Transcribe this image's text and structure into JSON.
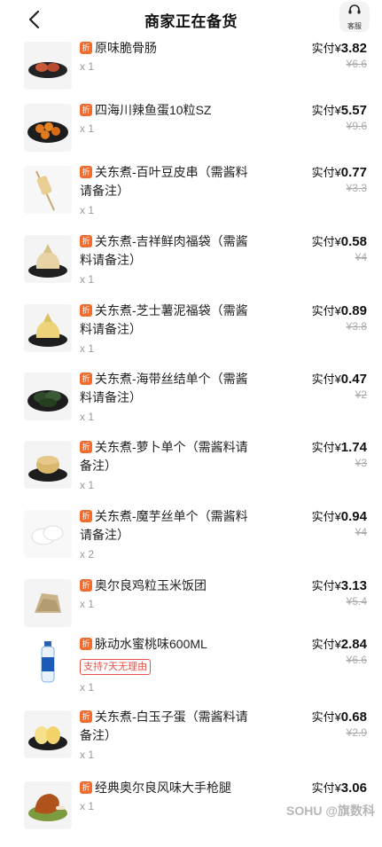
{
  "header": {
    "title": "商家正在备货",
    "service_label": "客服"
  },
  "tag_label": "折",
  "paid_prefix": "实付",
  "currency": "¥",
  "items": [
    {
      "name": "原味脆骨肠",
      "qty": "x 1",
      "paid": "3.82",
      "original": "¥6.6",
      "img": "sausage-image"
    },
    {
      "name": "四海川辣鱼蛋10粒SZ",
      "qty": "x 1",
      "paid": "5.57",
      "original": "¥9.6",
      "img": "fishball-image"
    },
    {
      "name": "关东煮-百叶豆皮串（需酱料请备注）",
      "qty": "x 1",
      "paid": "0.77",
      "original": "¥3.3",
      "img": "tofu-skewer-image"
    },
    {
      "name": "关东煮-吉祥鲜肉福袋（需酱料请备注）",
      "qty": "x 1",
      "paid": "0.58",
      "original": "¥4",
      "img": "meat-pouch-image"
    },
    {
      "name": "关东煮-芝士薯泥福袋（需酱料请备注）",
      "qty": "x 1",
      "paid": "0.89",
      "original": "¥3.8",
      "img": "cheese-pouch-image"
    },
    {
      "name": "关东煮-海带丝结单个（需酱料请备注）",
      "qty": "x 1",
      "paid": "0.47",
      "original": "¥2",
      "img": "kelp-knot-image"
    },
    {
      "name": "关东煮-萝卜单个（需酱料请备注）",
      "qty": "x 1",
      "paid": "1.74",
      "original": "¥3",
      "img": "radish-image"
    },
    {
      "name": "关东煮-魔芋丝单个（需酱料请备注）",
      "qty": "x 2",
      "paid": "0.94",
      "original": "¥4",
      "img": "konjac-image"
    },
    {
      "name": "奥尔良鸡粒玉米饭团",
      "qty": "x 1",
      "paid": "3.13",
      "original": "¥5.4",
      "img": "rice-ball-image"
    },
    {
      "name": "脉动水蜜桃味600ML",
      "qty": "x 1",
      "paid": "2.84",
      "original": "¥6.6",
      "img": "drink-bottle-image",
      "badge": "支持7天无理由"
    },
    {
      "name": "关东煮-白玉子蛋（需酱料请备注）",
      "qty": "x 1",
      "paid": "0.68",
      "original": "¥2.9",
      "img": "egg-image"
    },
    {
      "name": "经典奥尔良风味大手枪腿",
      "qty": "x 1",
      "paid": "3.06",
      "original": "",
      "img": "chicken-leg-image"
    }
  ],
  "watermark": "SOHU @旗数科"
}
